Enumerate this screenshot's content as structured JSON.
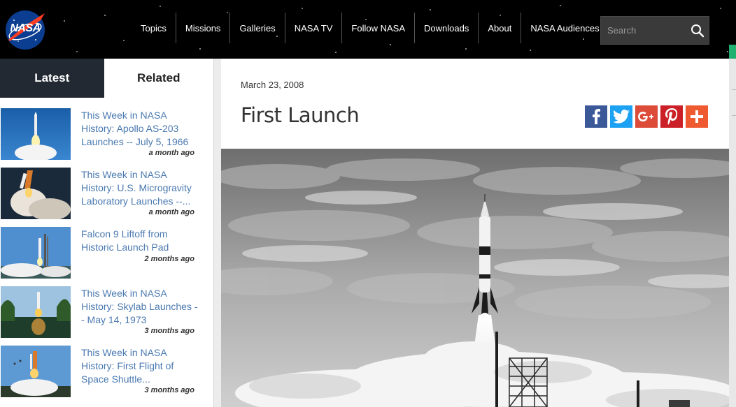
{
  "header": {
    "logo_text": "NASA",
    "nav": [
      "Topics",
      "Missions",
      "Galleries",
      "NASA TV",
      "Follow NASA",
      "Downloads",
      "About",
      "NASA Audiences"
    ],
    "search_placeholder": "Search"
  },
  "sidebar": {
    "tabs": [
      "Latest",
      "Related"
    ],
    "items": [
      {
        "title": "This Week in NASA History: Apollo AS-203 Launches -- July 5, 1966",
        "time": "a month ago"
      },
      {
        "title": "This Week in NASA History: U.S. Microgravity Laboratory Launches --...",
        "time": "a month ago"
      },
      {
        "title": "Falcon 9 Liftoff from Historic Launch Pad",
        "time": "2 months ago"
      },
      {
        "title": "This Week in NASA History: Skylab Launches -- May 14, 1973",
        "time": "3 months ago"
      },
      {
        "title": "This Week in NASA History: First Flight of Space Shuttle...",
        "time": "3 months ago"
      }
    ]
  },
  "article": {
    "date": "March 23, 2008",
    "title": "First Launch"
  },
  "share": [
    {
      "name": "facebook",
      "color": "#3b5998"
    },
    {
      "name": "twitter",
      "color": "#1da1f2"
    },
    {
      "name": "google-plus",
      "color": "#dd4b39"
    },
    {
      "name": "pinterest",
      "color": "#cb2027"
    },
    {
      "name": "more",
      "color": "#f05a30"
    }
  ],
  "colors": {
    "accent_link": "#4a79b0",
    "tab_dark": "#222933"
  }
}
